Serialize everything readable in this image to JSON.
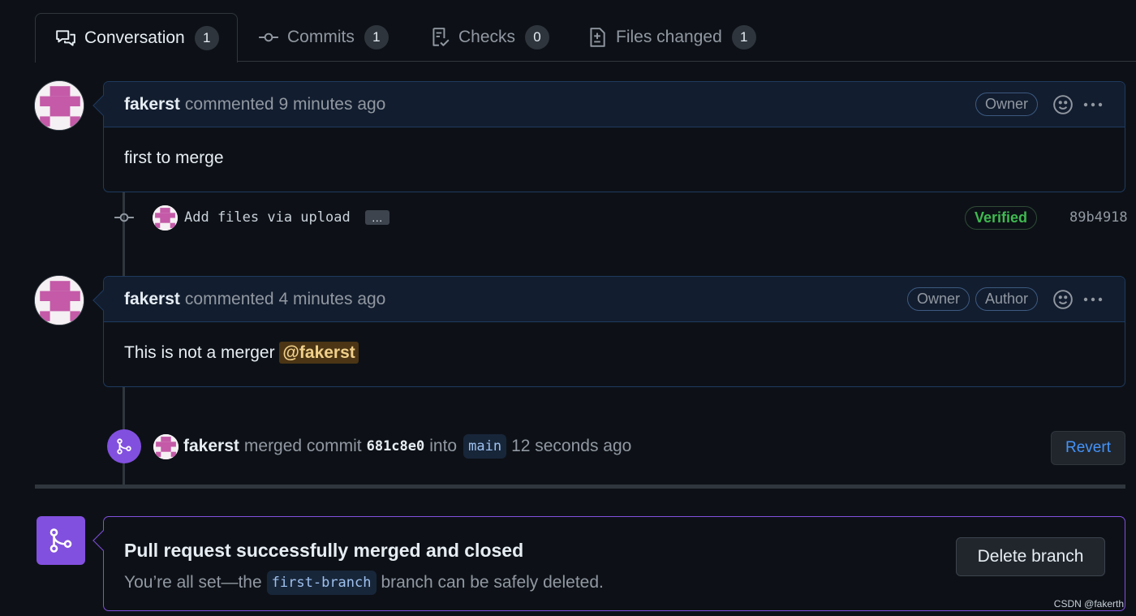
{
  "tabs": [
    {
      "label": "Conversation",
      "count": "1",
      "icon": "comment-discussion-icon"
    },
    {
      "label": "Commits",
      "count": "1",
      "icon": "git-commit-icon"
    },
    {
      "label": "Checks",
      "count": "0",
      "icon": "checklist-icon"
    },
    {
      "label": "Files changed",
      "count": "1",
      "icon": "file-diff-icon"
    }
  ],
  "comments": [
    {
      "author": "fakerst",
      "meta": "commented 9 minutes ago",
      "labels": [
        "Owner"
      ],
      "body": "first to merge"
    },
    {
      "author": "fakerst",
      "meta": "commented 4 minutes ago",
      "labels": [
        "Owner",
        "Author"
      ],
      "body": "This is not a merger",
      "mention": "@fakerst"
    }
  ],
  "commit": {
    "message": "Add files via upload",
    "ellipsis": "…",
    "verified": "Verified",
    "sha": "89b4918"
  },
  "merge_event": {
    "author": "fakerst",
    "action": "merged commit",
    "sha": "681c8e0",
    "into": "into",
    "branch": "main",
    "time": "12 seconds ago",
    "revert_label": "Revert"
  },
  "merged_box": {
    "title": "Pull request successfully merged and closed",
    "sub_prefix": "You’re all set—the",
    "branch": "first-branch",
    "sub_suffix": "branch can be safely deleted.",
    "delete_label": "Delete branch"
  },
  "watermark": "CSDN @fakerth",
  "colors": {
    "background": "#0d1117",
    "merged_purple": "#8250df",
    "verified_green": "#3fb950",
    "link_blue": "#4493f8"
  }
}
